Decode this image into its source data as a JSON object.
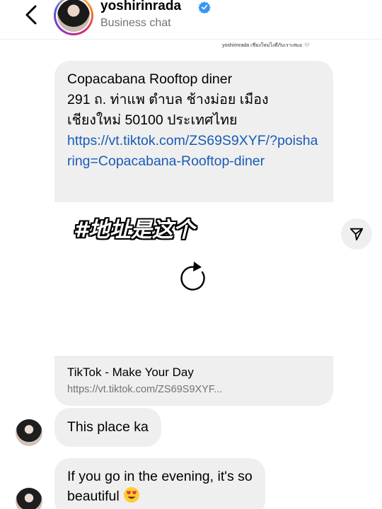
{
  "header": {
    "username": "yoshirinrada",
    "subtitle": "Business chat"
  },
  "share": {
    "caption": "yoshirinrada เชียงใหม่ไงดีกับเราเสมอ 🤍",
    "place_name": "Copacabana Rooftop diner",
    "address_line1": "291 ถ. ท่าแพ ตำบล ช้างม่อย เมือง",
    "address_line2": "เชียงใหม่ 50100 ประเทศไทย",
    "link": "https://vt.tiktok.com/ZS69S9XYF/?poisharing=Copacabana-Rooftop-diner",
    "overlay_text": "#地址是这个",
    "preview_title": "TikTok - Make Your Day",
    "preview_url": "https://vt.tiktok.com/ZS69S9XYF..."
  },
  "messages": [
    {
      "text": "This place ka"
    },
    {
      "text_line1": "If you go in the evening, it's so",
      "text_line2": "beautiful"
    }
  ],
  "colors": {
    "link": "#1a5bb5",
    "bubble": "#efefef",
    "verified": "#3897f0"
  },
  "icons": [
    "back-chevron-icon",
    "verified-badge-icon",
    "reload-icon",
    "send-icon",
    "heart-eyes-emoji"
  ]
}
